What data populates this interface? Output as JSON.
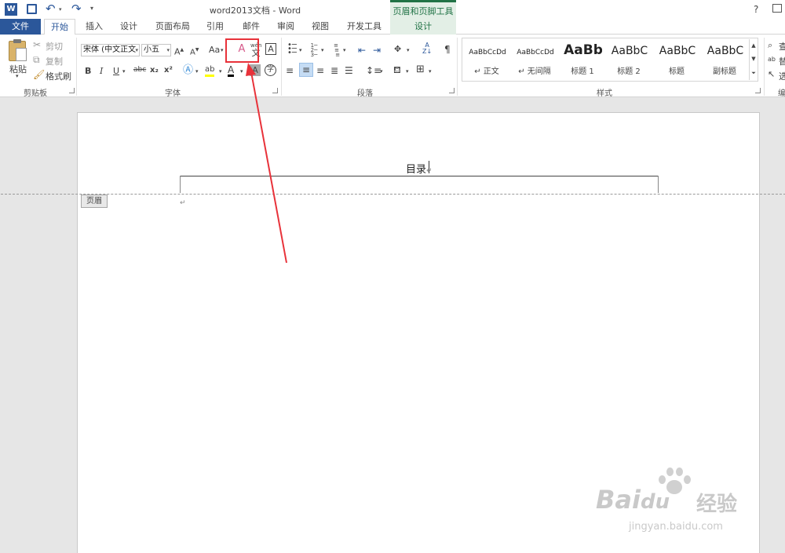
{
  "window": {
    "title": "word2013文档 - Word",
    "context_group": "页眉和页脚工具",
    "help": "?"
  },
  "tabs": [
    {
      "label": "文件",
      "active": false
    },
    {
      "label": "开始",
      "active": true
    },
    {
      "label": "插入"
    },
    {
      "label": "设计"
    },
    {
      "label": "页面布局"
    },
    {
      "label": "引用"
    },
    {
      "label": "邮件"
    },
    {
      "label": "审阅"
    },
    {
      "label": "视图"
    },
    {
      "label": "开发工具"
    },
    {
      "label": "设计",
      "contextual": true
    }
  ],
  "clipboard": {
    "paste": "粘贴",
    "cut": "剪切",
    "copy": "复制",
    "format_painter": "格式刷",
    "group": "剪贴板"
  },
  "font": {
    "name": "宋体 (中文正文",
    "size": "小五",
    "change_case": "Aa",
    "bold": "B",
    "italic": "I",
    "underline": "U",
    "strikethrough": "abc",
    "subscript": "x₂",
    "superscript": "x²",
    "group": "字体"
  },
  "paragraph": {
    "group": "段落"
  },
  "styles": {
    "group": "样式",
    "items": [
      {
        "sample": "AaBbCcDd",
        "name": "↵ 正文"
      },
      {
        "sample": "AaBbCcDd",
        "name": "↵ 无间隔"
      },
      {
        "sample": "AaBb",
        "name": "标题 1"
      },
      {
        "sample": "AaBbC",
        "name": "标题 2"
      },
      {
        "sample": "AaBbC",
        "name": "标题"
      },
      {
        "sample": "AaBbC",
        "name": "副标题"
      }
    ]
  },
  "editing": {
    "find": "查",
    "replace": "替",
    "select": "选",
    "group_initial": "编"
  },
  "document": {
    "header_text": "目录",
    "header_tag": "页眉",
    "para_mark": "↵"
  },
  "watermark": {
    "brand": "Bai",
    "brand_suffix": "du",
    "cn": "经验",
    "url": "jingyan.baidu.com"
  },
  "colors": {
    "accent_blue": "#2b579a",
    "context_green": "#217346",
    "annotation_red": "#e8323a"
  }
}
